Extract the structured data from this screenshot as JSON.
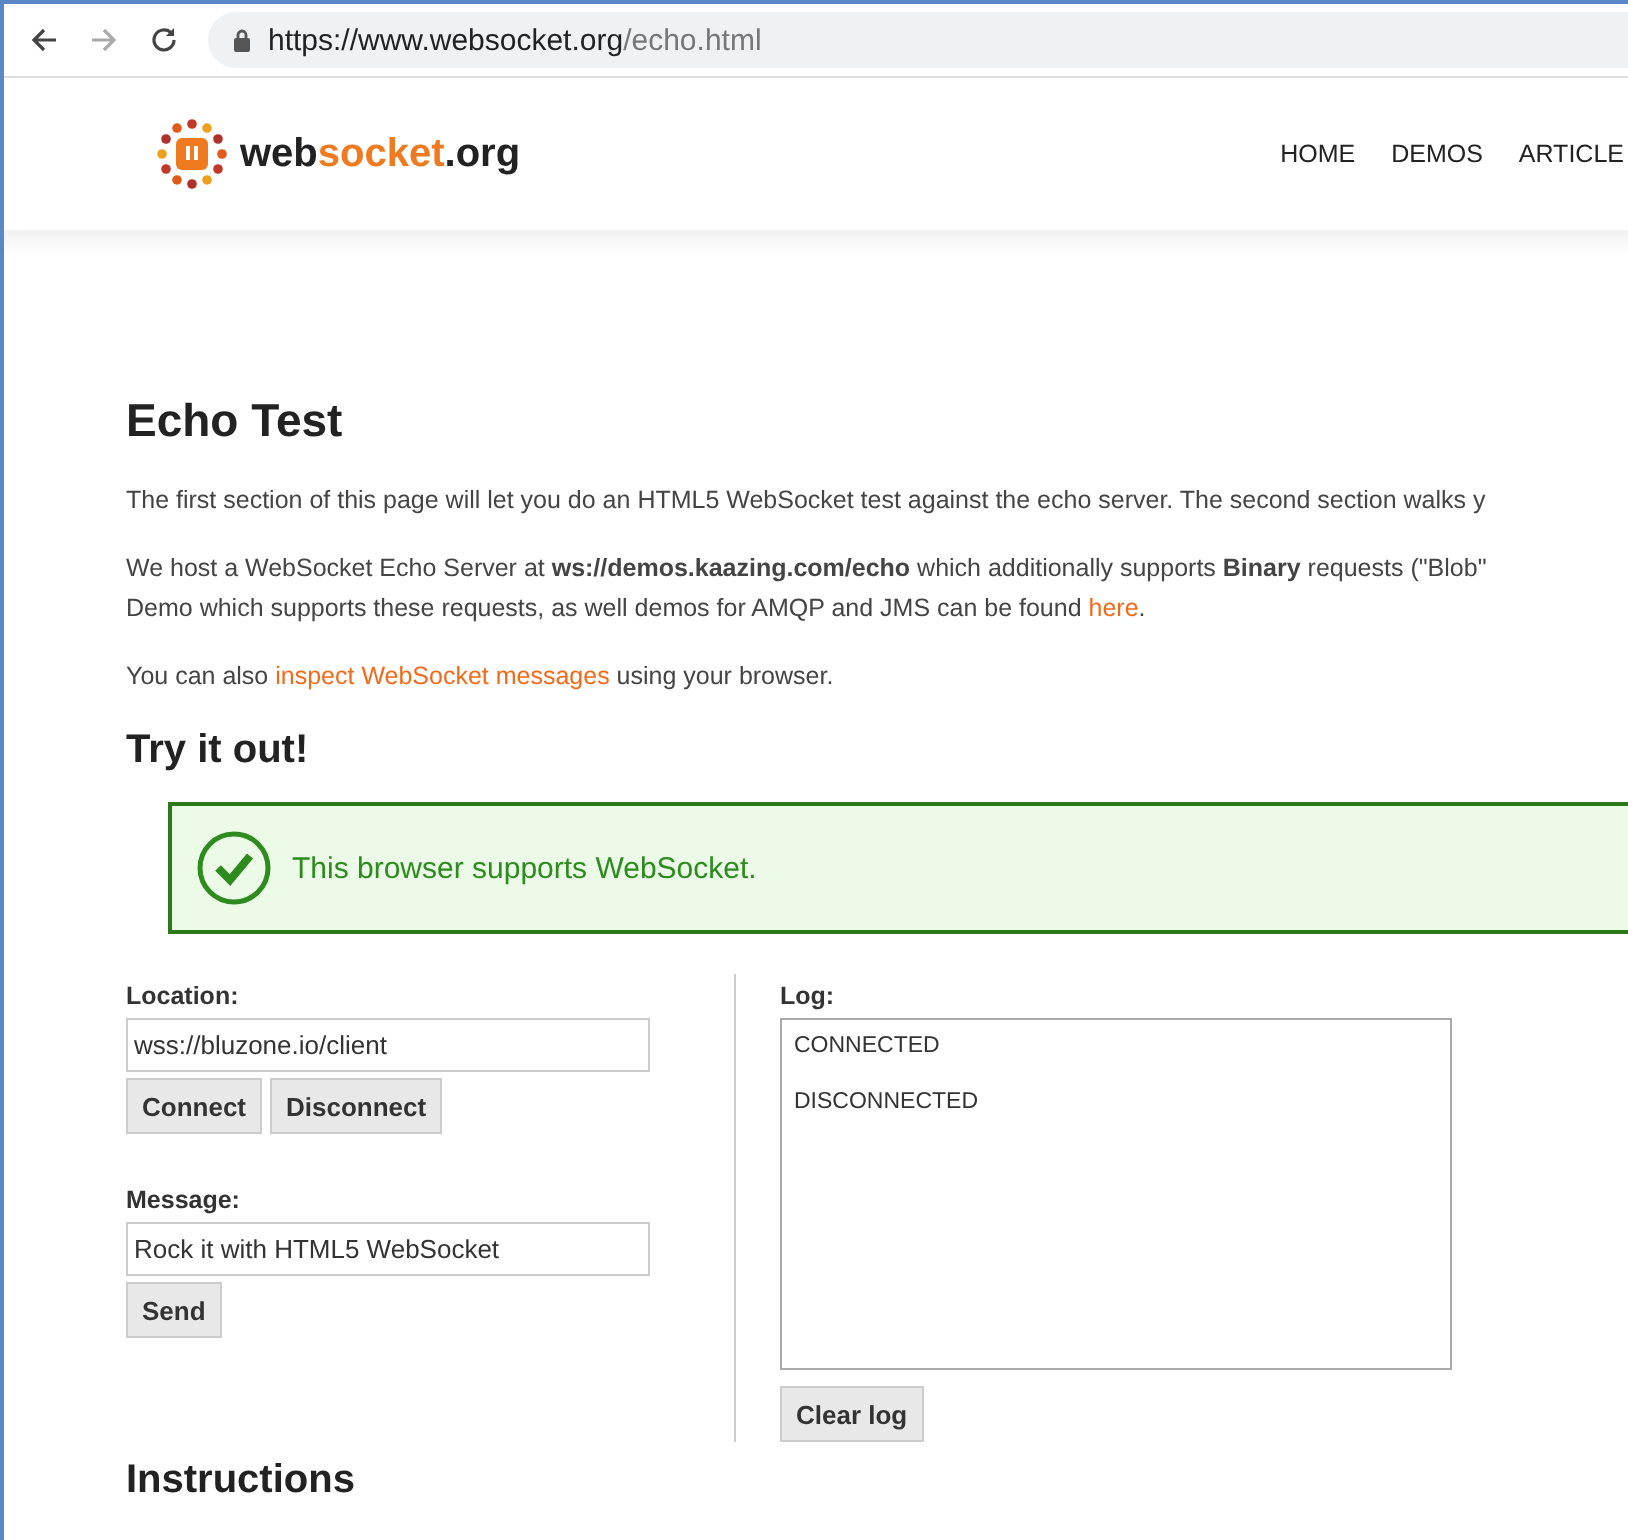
{
  "browser": {
    "url_base": "https://www.websocket.org",
    "url_path": "/echo.html"
  },
  "logo": {
    "parts": [
      "web",
      "socket",
      ".org"
    ]
  },
  "nav": [
    {
      "label": "HOME"
    },
    {
      "label": "DEMOS"
    },
    {
      "label": "ARTICLE"
    }
  ],
  "title": "Echo Test",
  "paragraphs": [
    [
      {
        "kind": "text",
        "text": "The first section of this page will let you do an HTML5 WebSocket test against the echo server. The second section walks y"
      }
    ],
    [
      {
        "kind": "text",
        "text": "We host a WebSocket Echo Server at **ws://demos.kaazing.com/echo** which additionally supports **Binary** requests (\"Blob\""
      },
      {
        "kind": "break"
      },
      {
        "kind": "text",
        "text": "Demo which supports these requests, as well demos for AMQP and JMS can be found "
      },
      {
        "kind": "link",
        "text": "here"
      },
      {
        "kind": "text",
        "text": "."
      }
    ],
    [
      {
        "kind": "text",
        "text": "You can also "
      },
      {
        "kind": "link",
        "text": "inspect WebSocket messages"
      },
      {
        "kind": "text",
        "text": " using your browser."
      }
    ]
  ],
  "try_heading": "Try it out!",
  "status": {
    "supported": true,
    "text": "This browser supports WebSocket."
  },
  "location": {
    "label": "Location:",
    "value": "wss://bluzone.io/client",
    "buttons": [
      "Connect",
      "Disconnect"
    ]
  },
  "message": {
    "label": "Message:",
    "value": "Rock it with HTML5 WebSocket",
    "buttons": [
      "Send"
    ]
  },
  "log": {
    "label": "Log:",
    "entries": [
      "CONNECTED",
      "DISCONNECTED"
    ],
    "button": "Clear log"
  },
  "next_heading": "Instructions"
}
